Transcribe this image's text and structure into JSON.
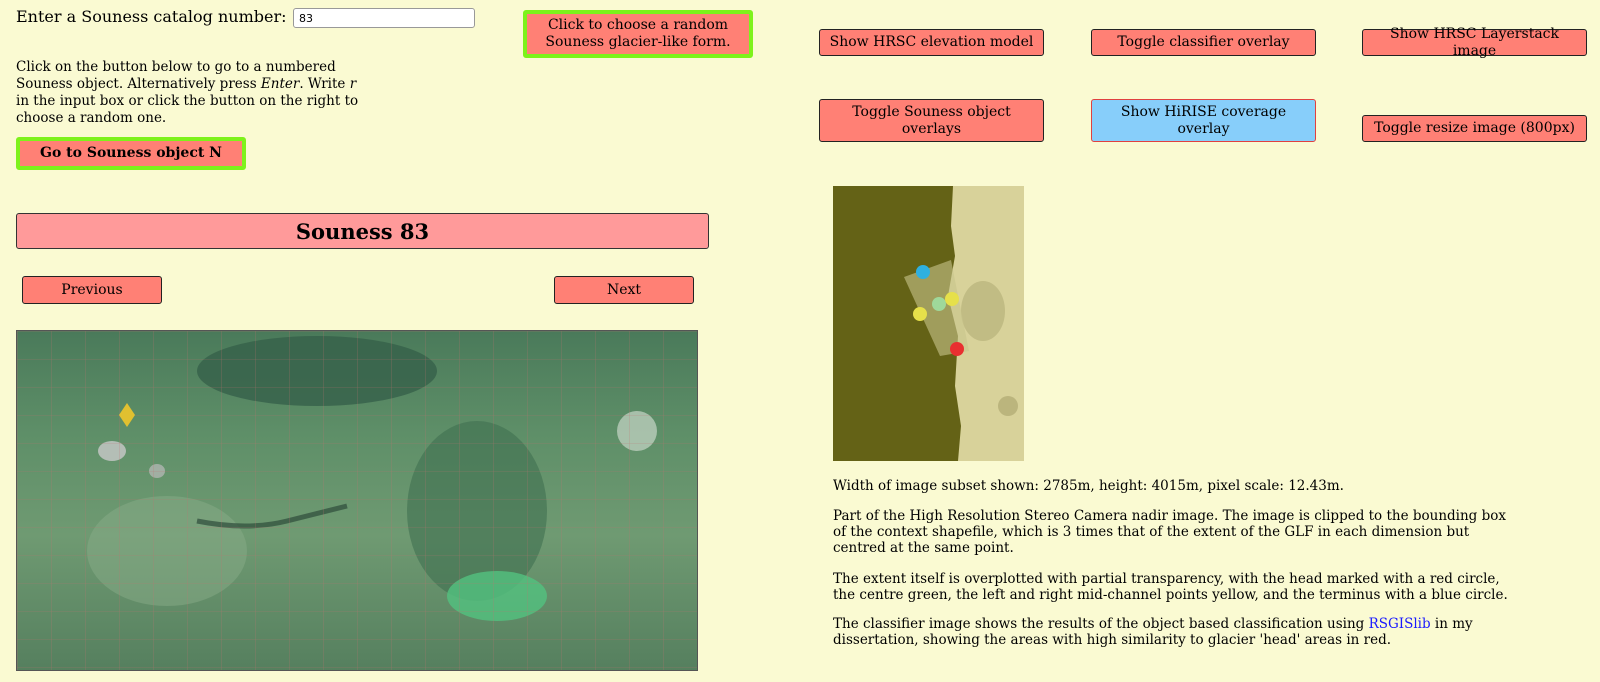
{
  "header": {
    "catalog_label": "Enter a Souness catalog number:",
    "catalog_value": "83"
  },
  "help": {
    "p1": "Click on the button below to go to a numbered Souness object. Alternatively press ",
    "enter": "Enter",
    "p2": ". Write ",
    "r": "r",
    "p3": " in the input box or click the button on the right to choose a random one."
  },
  "buttons": {
    "go": "Go to Souness object N",
    "random": "Click to choose a random Souness glacier-like form.",
    "previous": "Previous",
    "next": "Next",
    "hrsc_elevation": "Show HRSC elevation model",
    "toggle_classifier": "Toggle classifier overlay",
    "hrsc_layerstack": "Show HRSC Layerstack image",
    "toggle_souness": "Toggle Souness object overlays",
    "hirise_coverage": "Show HiRISE coverage overlay",
    "toggle_resize": "Toggle resize image (800px)"
  },
  "object": {
    "title": "Souness 83"
  },
  "description": {
    "width_text": "Width of image subset shown: 2785m, height: 4015m, pixel scale: 12.43m.",
    "part_text": "Part of the High Resolution Stereo Camera nadir image. The image is clipped to the bounding box of the context shapefile, which is 3 times that of the extent of the GLF in each dimension but centred at the same point.",
    "extent_text": "The extent itself is overplotted with partial transparency, with the head marked with a red circle, the centre green, the left and right mid-channel points yellow, and the terminus with a blue circle.",
    "class_before": "The classifier image shows the results of the object based classification using ",
    "class_link": "RSGISlib",
    "class_after": " in my dissertation, showing the areas with high similarity to glacier 'head' areas in red."
  },
  "colors": {
    "background": "#fafad2",
    "button": "#ff8075",
    "title_bar": "#ff9a9a",
    "hirise_button": "#87cefa",
    "highlight_border": "#7df21b",
    "link": "#1a1aff"
  }
}
